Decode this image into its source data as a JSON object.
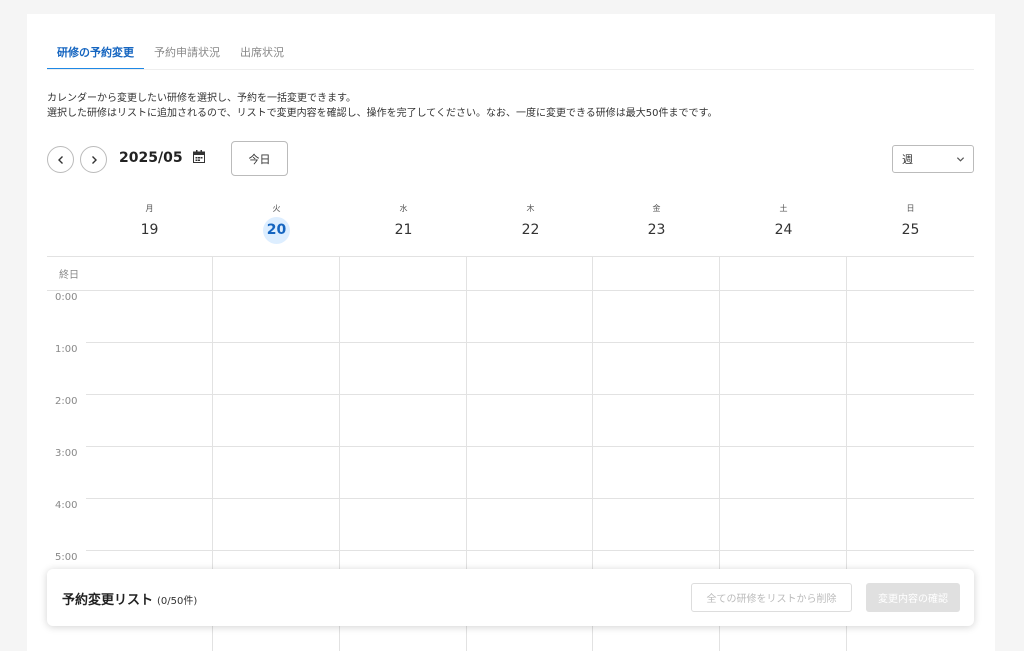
{
  "tabs": [
    {
      "label": "研修の予約変更",
      "active": true
    },
    {
      "label": "予約申請状況",
      "active": false
    },
    {
      "label": "出席状況",
      "active": false
    }
  ],
  "description": {
    "line1": "カレンダーから変更したい研修を選択し、予約を一括変更できます。",
    "line2": "選択した研修はリストに追加されるので、リストで変更内容を確認し、操作を完了してください。なお、一度に変更できる研修は最大50件までです。"
  },
  "toolbar": {
    "month": "2025/05",
    "today_label": "今日",
    "view_selected": "週"
  },
  "calendar": {
    "days": [
      {
        "weekday": "月",
        "date": "19",
        "today": false
      },
      {
        "weekday": "火",
        "date": "20",
        "today": true
      },
      {
        "weekday": "水",
        "date": "21",
        "today": false
      },
      {
        "weekday": "木",
        "date": "22",
        "today": false
      },
      {
        "weekday": "金",
        "date": "23",
        "today": false
      },
      {
        "weekday": "土",
        "date": "24",
        "today": false
      },
      {
        "weekday": "日",
        "date": "25",
        "today": false
      }
    ],
    "allday_label": "終日",
    "times": [
      "0:00",
      "1:00",
      "2:00",
      "3:00",
      "4:00",
      "5:00"
    ]
  },
  "bottom_bar": {
    "title": "予約変更リスト",
    "count": "(0/50件)",
    "clear_label": "全ての研修をリストから削除",
    "confirm_label": "変更内容の確認"
  },
  "colors": {
    "accent": "#1e88e5",
    "today_bg": "#ddeeff"
  }
}
